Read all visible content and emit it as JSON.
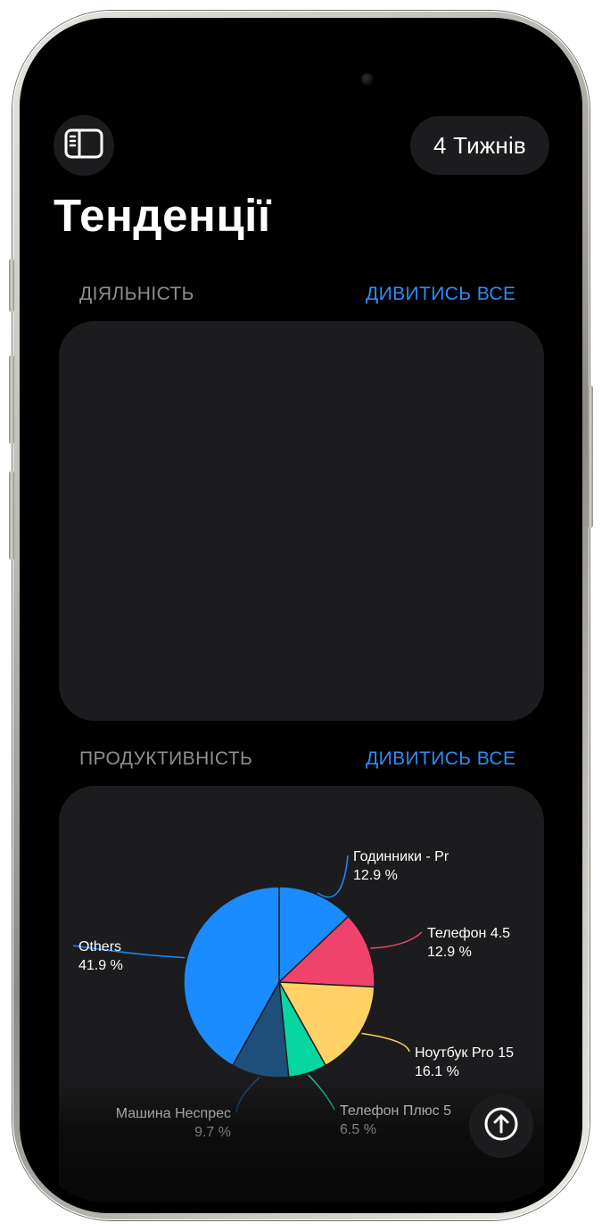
{
  "header": {
    "sidebar_icon": "sidebar-icon",
    "range_label": "4 Тижнів",
    "title": "Тенденції"
  },
  "sections": {
    "activity": {
      "title": "ДІЯЛЬНІСТЬ",
      "see_all": "ДИВИТИСЬ ВСЕ"
    },
    "productivity": {
      "title": "ПРОДУКТИВНІСТЬ",
      "see_all": "ДИВИТИСЬ ВСЕ"
    }
  },
  "scroll_top_icon": "arrow-up-circle-icon",
  "colors": {
    "accent": "#2f8cf5",
    "background": "#000000",
    "card": "#1c1c1e"
  },
  "chart_data": {
    "type": "pie",
    "title": "",
    "slices": [
      {
        "label": "Годинники - Pr",
        "value": 12.9,
        "value_label": "12.9 %",
        "color": "#1a8cff"
      },
      {
        "label": "Телефон 4.5",
        "value": 12.9,
        "value_label": "12.9 %",
        "color": "#f0436c"
      },
      {
        "label": "Ноутбук Pro 15",
        "value": 16.1,
        "value_label": "16.1 %",
        "color": "#ffd166"
      },
      {
        "label": "Телефон Плюс 5",
        "value": 6.5,
        "value_label": "6.5 %",
        "color": "#06d6a0"
      },
      {
        "label": "Машина Неспрес",
        "value": 9.7,
        "value_label": "9.7 %",
        "color": "#1e4f7a"
      },
      {
        "label": "Others",
        "value": 41.9,
        "value_label": "41.9 %",
        "color": "#1a8cff"
      }
    ]
  }
}
